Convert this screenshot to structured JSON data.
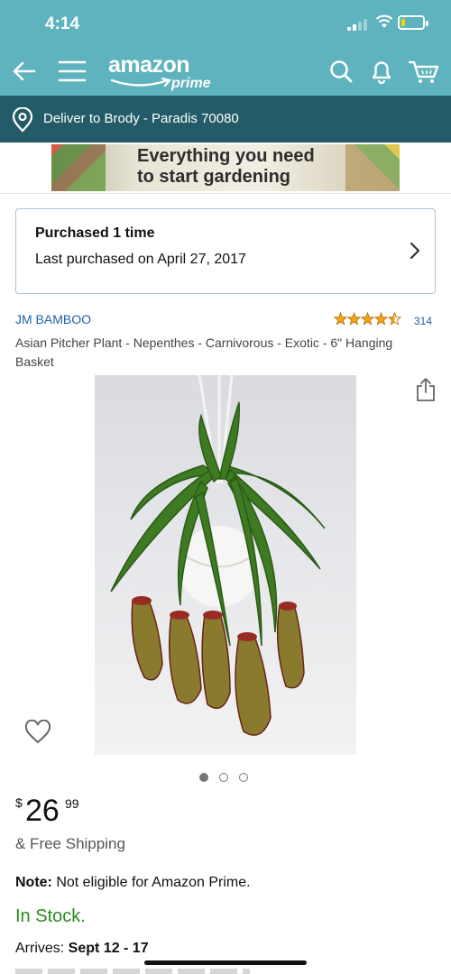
{
  "status_bar": {
    "time": "4:14",
    "battery_fraction": 0.2
  },
  "header": {
    "logo_word": "amazon",
    "logo_sub": "prime",
    "icons": [
      "back-arrow-icon",
      "menu-icon",
      "search-icon",
      "bell-icon",
      "cart-icon"
    ]
  },
  "delivery": {
    "text": "Deliver to Brody - Paradis 70080"
  },
  "banner": {
    "line1": "Everything you need",
    "line2": "to start gardening"
  },
  "purchase_history": {
    "title": "Purchased 1 time",
    "last_purchased": "Last purchased on April 27, 2017"
  },
  "product": {
    "brand": "JM BAMBOO",
    "rating_stars": 4.5,
    "rating_count": "314",
    "title": "Asian Pitcher Plant - Nepenthes - Carnivorous - Exotic - 6\" Hanging Basket",
    "image_count": 3,
    "active_image": 0
  },
  "pricing": {
    "currency": "$",
    "whole": "26",
    "fraction": "99",
    "shipping": "& Free Shipping",
    "note_label": "Note:",
    "note_text": " Not eligible for Amazon Prime.",
    "stock": "In Stock.",
    "arrives_label": "Arrives: ",
    "arrives_date": "Sept 12 - 17"
  },
  "colors": {
    "header": "#5eb3be",
    "delivery_bar": "#235b68",
    "link": "#1d61a8",
    "stock": "#2b8a1f",
    "star": "#f0a41b"
  }
}
